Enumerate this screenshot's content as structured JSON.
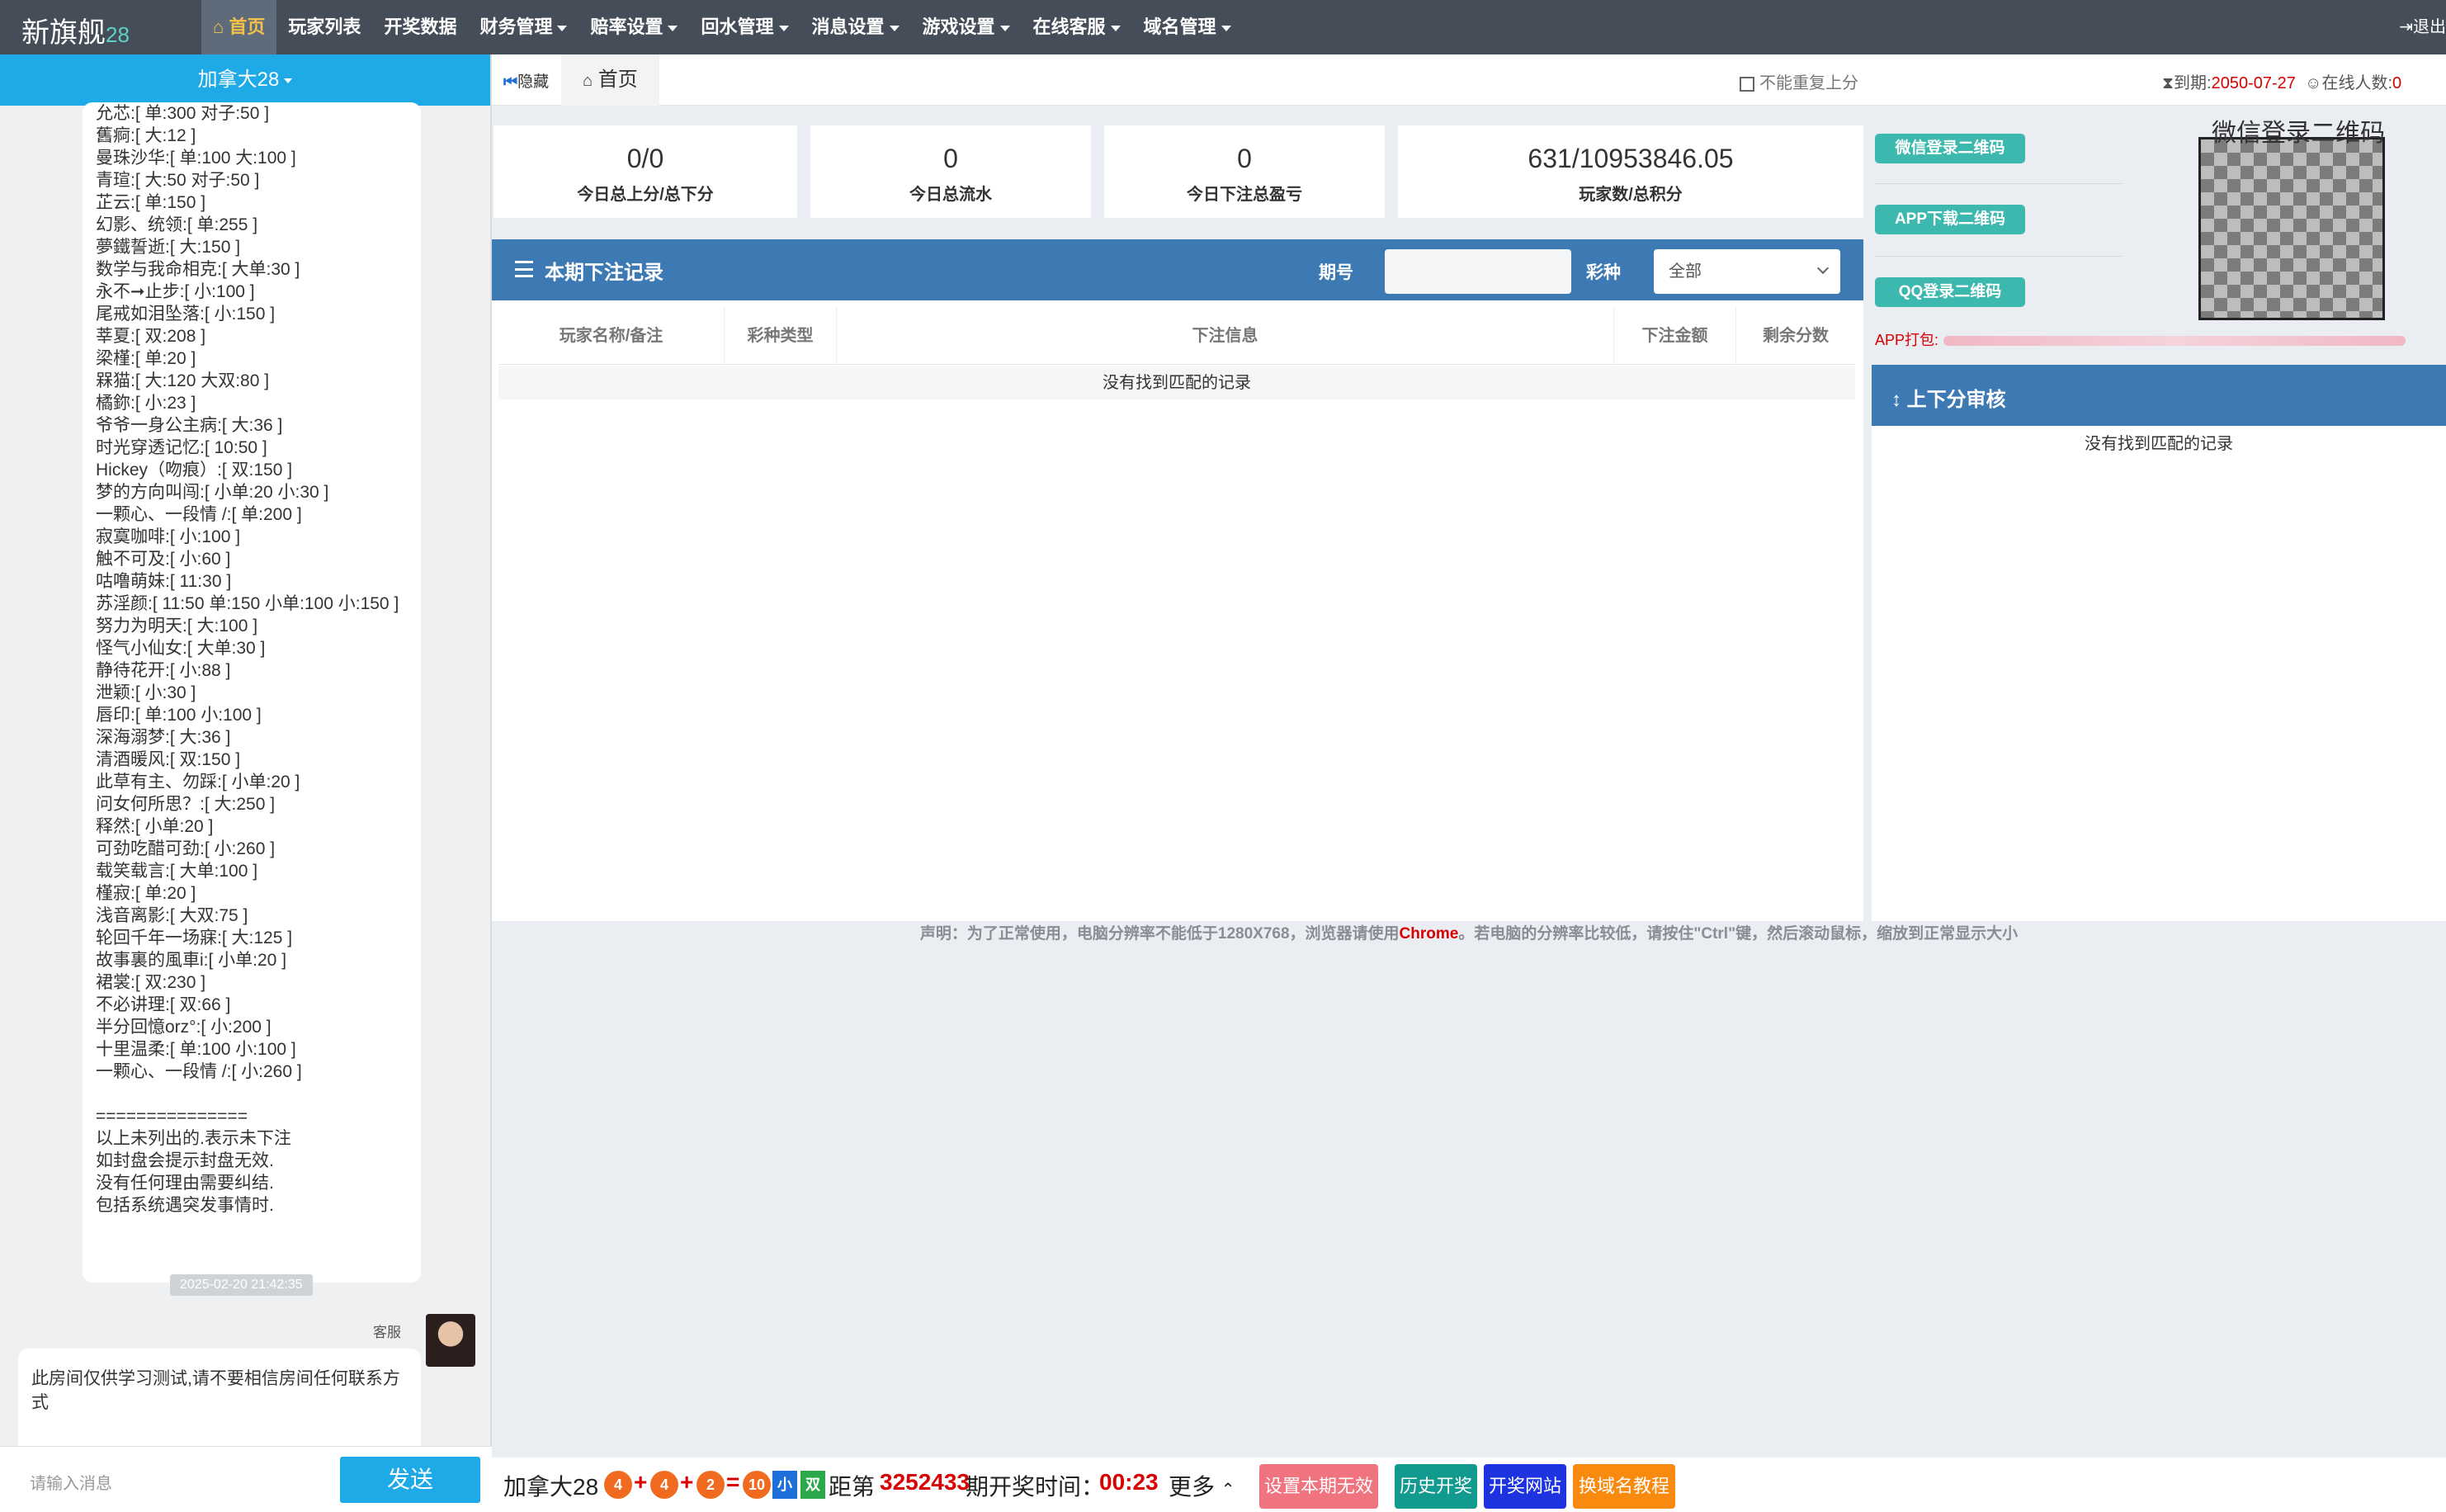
{
  "nav": {
    "brand": "新旗舰",
    "brand_num": "28",
    "menu": [
      {
        "label": "首页",
        "caret": false,
        "active": true
      },
      {
        "label": "玩家列表",
        "caret": false
      },
      {
        "label": "开奖数据",
        "caret": false
      },
      {
        "label": "财务管理",
        "caret": true
      },
      {
        "label": "赔率设置",
        "caret": true
      },
      {
        "label": "回水管理",
        "caret": true
      },
      {
        "label": "消息设置",
        "caret": true
      },
      {
        "label": "游戏设置",
        "caret": true
      },
      {
        "label": "在线客服",
        "caret": true
      },
      {
        "label": "域名管理",
        "caret": true
      }
    ],
    "logout": "退出"
  },
  "sidebar": {
    "room": "加拿大28",
    "bubble_lines": [
      "允芯:[ 单:300 对子:50 ]",
      "舊痾:[ 大:12 ]",
      "曼珠沙华:[ 单:100 大:100 ]",
      "青瑄:[ 大:50 对子:50 ]",
      "芷云:[ 单:150 ]",
      "幻影、统领:[ 单:255 ]",
      "夢鐵誓逝:[ 大:150 ]",
      "数学与我命相克:[ 大单:30 ]",
      "永不➞止步:[ 小:100 ]",
      "尾戒如泪坠落:[ 小:150 ]",
      "莘夏:[ 双:208 ]",
      "梁槿:[ 单:20 ]",
      "槑猫:[ 大:120 大双:80 ]",
      "橘鉨:[ 小:23 ]",
      "爷爷一身公主病:[ 大:36 ]",
      "时光穿透记忆:[ 10:50 ]",
      "Hickey（吻痕）:[ 双:150 ]",
      "梦的方向叫闯:[ 小单:20 小:30 ]",
      "一颗心、一段情 /:[ 单:200 ]",
      "寂寞咖啡:[ 小:100 ]",
      "触不可及:[ 小:60 ]",
      "咕噜萌妹:[ 11:30 ]",
      "苏淫颜:[ 11:50 单:150 小单:100 小:150 ]",
      "努力为明天:[ 大:100 ]",
      "怪气小仙女:[ 大单:30 ]",
      "静待花开:[ 小:88 ]",
      "泄颖:[ 小:30 ]",
      "唇印:[ 单:100 小:100 ]",
      "深海溺梦:[ 大:36 ]",
      "清酒暖风:[ 双:150 ]",
      "此草有主、勿踩:[ 小单:20 ]",
      "问女何所思？:[ 大:250 ]",
      "释然:[ 小单:20 ]",
      "可劲吃醋可劲:[ 小:260 ]",
      "载笑载言:[ 大单:100 ]",
      "槿寂:[ 单:20 ]",
      "浅音离影:[ 大双:75 ]",
      "轮回千年一场寐:[ 大:125 ]",
      "故事裏的風車i:[ 小单:20 ]",
      "裙裳:[ 双:230 ]",
      "不必讲理:[ 双:66 ]",
      "半分回憶orz°:[ 小:200 ]",
      "十里温柔:[ 单:100 小:100 ]",
      "一颗心、一段情 /:[ 小:260 ]",
      "",
      "===============",
      "以上未列出的.表示未下注",
      "如封盘会提示封盘无效.",
      "没有任何理由需要纠结.",
      "包括系统遇突发事情时."
    ],
    "timestamp": "2025-02-20 21:42:35",
    "kefu_name": "客服",
    "kefu_msg": "此房间仅供学习测试,请不要相信房间任何联系方式",
    "input_placeholder": "请输入消息",
    "send": "发送"
  },
  "tabbar": {
    "hide": "隐藏",
    "home_tab": "首页",
    "no_repeat": "不能重复上分",
    "expire_label": "到期:",
    "expire_date": "2050-07-27",
    "online_label": "在线人数:",
    "online_count": "0"
  },
  "stats": [
    {
      "value": "0/0",
      "label": "今日总上分/总下分"
    },
    {
      "value": "0",
      "label": "今日总流水"
    },
    {
      "value": "0",
      "label": "今日下注总盈亏"
    },
    {
      "value": "631/10953846.05",
      "label": "玩家数/总积分"
    }
  ],
  "bets": {
    "title": "本期下注记录",
    "issue_label": "期号",
    "type_label": "彩种",
    "type_value": "全部",
    "columns": [
      "玩家名称/备注",
      "彩种类型",
      "下注信息",
      "下注金额",
      "剩余分数"
    ],
    "empty": "没有找到匹配的记录"
  },
  "qr": {
    "wechat_btn": "微信登录二维码",
    "app_btn": "APP下载二维码",
    "qq_btn": "QQ登录二维码",
    "title": "微信登录二维码",
    "app_pack": "APP打包:"
  },
  "audit": {
    "title": "上下分审核",
    "empty": "没有找到匹配的记录"
  },
  "notice": {
    "pre": "声明：为了正常使用，电脑分辨率不能低于1280X768，浏览器请使用",
    "browser": "Chrome",
    "post": "。若电脑的分辨率比较低，请按住\"Ctrl\"键，然后滚动鼠标，缩放到正常显示大小"
  },
  "bottom": {
    "room": "加拿大28",
    "balls": [
      "4",
      "4",
      "2",
      "10"
    ],
    "ops": [
      "+",
      "+",
      "="
    ],
    "tag1": "小",
    "tag2": "双",
    "pre": "距第",
    "issue": "3252433",
    "suffix": "期开奖时间：",
    "timer": "00:23",
    "more": "更多",
    "buttons": [
      "设置本期无效",
      "历史开奖",
      "开奖网站",
      "换域名教程"
    ]
  },
  "colors": {
    "nav": "#444d58",
    "accent": "#1ea9e7",
    "panel_head": "#3d7ab4",
    "red": "#d80000",
    "ball": "#f06a1f",
    "teal": "#3cb8ae"
  }
}
